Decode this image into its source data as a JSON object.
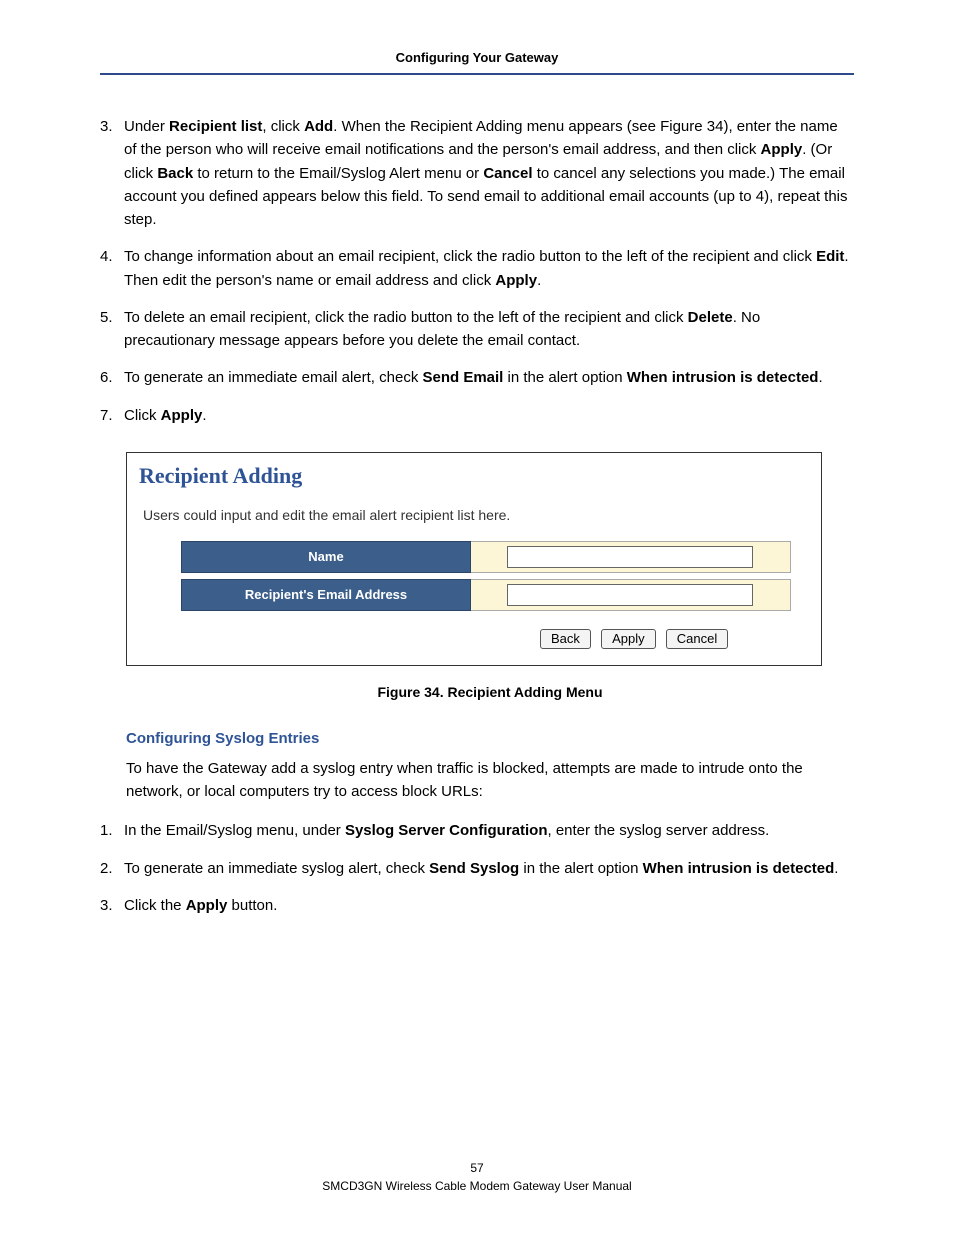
{
  "header": {
    "title": "Configuring Your Gateway"
  },
  "steps_a": [
    {
      "num": "3.",
      "html": "Under <b>Recipient list</b>, click <b>Add</b>. When the Recipient Adding menu appears (see Figure 34), enter the name of the person who will receive email notifications and the person's email address, and then click <b>Apply</b>. (Or click <b>Back</b> to return to the Email/Syslog Alert menu or <b>Cancel</b> to cancel any selections you made.) The email account you defined appears below this field. To send email to additional email accounts (up to 4), repeat this step."
    },
    {
      "num": "4.",
      "html": "To change information about an email recipient, click the radio button to the left of the recipient and click <b>Edit</b>. Then edit the person's name or email address and click <b>Apply</b>."
    },
    {
      "num": "5.",
      "html": "To delete an email recipient, click the radio button to the left of the recipient and click <b>Delete</b>. No precautionary message appears before you delete the email contact."
    },
    {
      "num": "6.",
      "html": "To generate an immediate email alert, check <b>Send Email</b> in the alert option <b>When intrusion is detected</b>."
    },
    {
      "num": "7.",
      "html": "Click <b>Apply</b>."
    }
  ],
  "figure": {
    "title": "Recipient Adding",
    "desc": "Users could input and edit the email alert recipient list here.",
    "rows": [
      {
        "label": "Name",
        "value": ""
      },
      {
        "label": "Recipient's Email Address",
        "value": ""
      }
    ],
    "buttons": {
      "back": "Back",
      "apply": "Apply",
      "cancel": "Cancel"
    },
    "caption": "Figure 34. Recipient Adding Menu"
  },
  "section": {
    "title": "Configuring Syslog Entries",
    "intro": "To have the Gateway add a syslog entry when traffic is blocked, attempts are made to intrude onto the network, or local computers try to access block URLs:"
  },
  "steps_b": [
    {
      "num": "1.",
      "html": "In the Email/Syslog menu, under <b>Syslog Server Configuration</b>, enter the syslog server address."
    },
    {
      "num": "2.",
      "html": "To generate an immediate syslog alert, check <b>Send Syslog</b> in the alert option <b>When intrusion is detected</b>."
    },
    {
      "num": "3.",
      "html": "Click the <b>Apply</b> button."
    }
  ],
  "footer": {
    "page": "57",
    "doc": "SMCD3GN Wireless Cable Modem Gateway User Manual"
  }
}
